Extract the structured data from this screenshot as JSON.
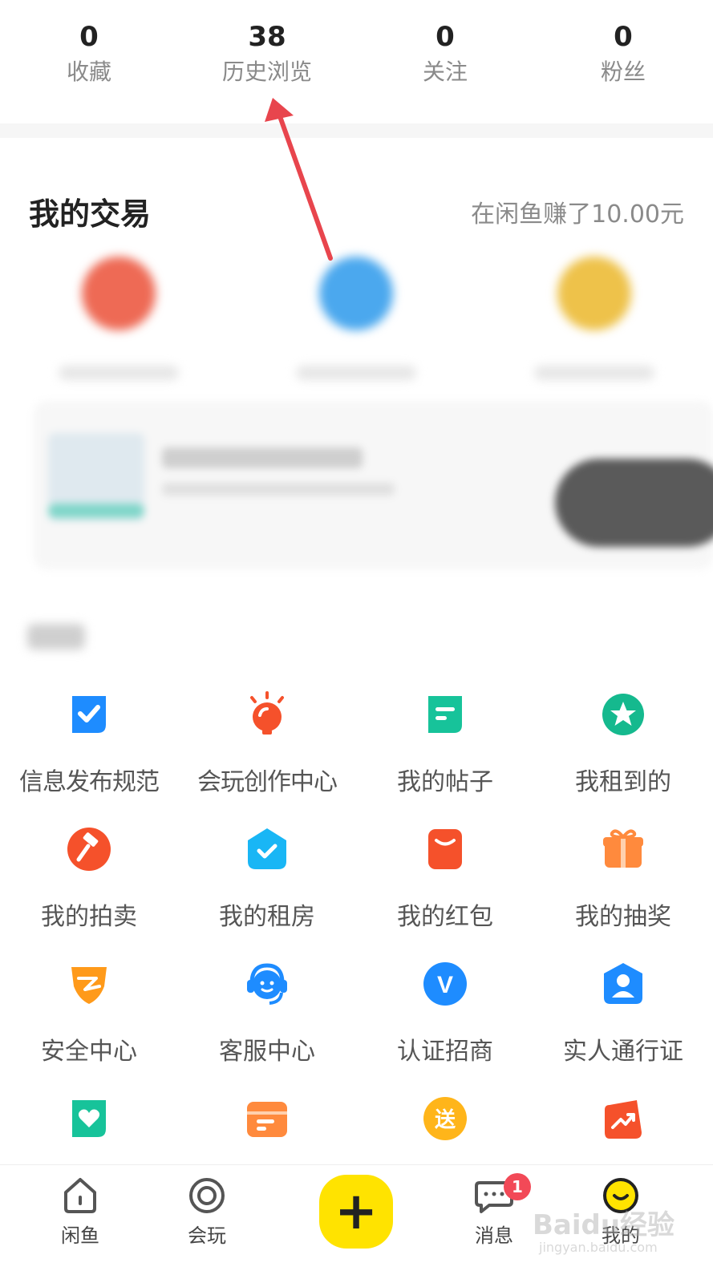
{
  "stats": [
    {
      "value": "0",
      "label": "收藏"
    },
    {
      "value": "38",
      "label": "历史浏览"
    },
    {
      "value": "0",
      "label": "关注"
    },
    {
      "value": "0",
      "label": "粉丝"
    }
  ],
  "trade": {
    "title": "我的交易",
    "earned": "在闲鱼赚了10.00元"
  },
  "tools": [
    {
      "label": "信息发布规范",
      "icon": "check-shield-icon",
      "color": "#1e8cff"
    },
    {
      "label": "会玩创作中心",
      "icon": "lightbulb-icon",
      "color": "#f5512b"
    },
    {
      "label": "我的帖子",
      "icon": "post-icon",
      "color": "#17c39a"
    },
    {
      "label": "我租到的",
      "icon": "star-badge-icon",
      "color": "#15b98e"
    },
    {
      "label": "我的拍卖",
      "icon": "auction-hammer-icon",
      "color": "#f5512b"
    },
    {
      "label": "我的租房",
      "icon": "house-check-icon",
      "color": "#19b6f5"
    },
    {
      "label": "我的红包",
      "icon": "red-envelope-icon",
      "color": "#f5512b"
    },
    {
      "label": "我的抽奖",
      "icon": "gift-box-icon",
      "color": "#ff8a3d"
    },
    {
      "label": "安全中心",
      "icon": "security-shield-icon",
      "color": "#ff9a1a"
    },
    {
      "label": "客服中心",
      "icon": "customer-service-icon",
      "color": "#1e8cff"
    },
    {
      "label": "认证招商",
      "icon": "verified-v-icon",
      "color": "#1e8cff"
    },
    {
      "label": "实人通行证",
      "icon": "person-badge-icon",
      "color": "#1e8cff"
    },
    {
      "label": "",
      "icon": "heart-icon",
      "color": "#17c39a"
    },
    {
      "label": "",
      "icon": "box-icon",
      "color": "#ff8a3d"
    },
    {
      "label": "",
      "icon": "give-icon",
      "color": "#ffb51a",
      "glyph": "送"
    },
    {
      "label": "",
      "icon": "trend-bag-icon",
      "color": "#f5512b"
    }
  ],
  "tabbar": {
    "home": "闲鱼",
    "play": "会玩",
    "publish": "+",
    "messages": "消息",
    "messages_badge": "1",
    "me": "我的"
  },
  "watermark": {
    "brand": "Baidu经验",
    "url": "jingyan.baidu.com"
  },
  "colors": {
    "annotation_arrow": "#e8454d",
    "publish_button": "#ffe300",
    "badge": "#f24957"
  }
}
